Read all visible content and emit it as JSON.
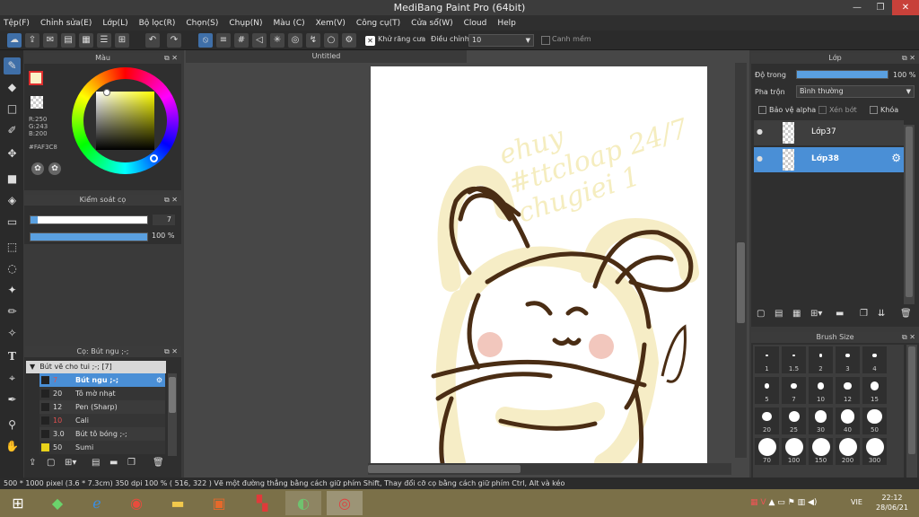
{
  "app": {
    "title": "MediBang Paint Pro (64bit)"
  },
  "menu": [
    "Tệp(F)",
    "Chỉnh sửa(E)",
    "Lớp(L)",
    "Bộ lọc(R)",
    "Chọn(S)",
    "Chụp(N)",
    "Màu (C)",
    "Xem(V)",
    "Công cụ(T)",
    "Cửa sổ(W)",
    "Cloud",
    "Help"
  ],
  "toolbar": {
    "antialias": "Khử răng cưa",
    "adjust": "Điều chỉnh",
    "adjust_value": "10",
    "canh_mem": "Canh mềm"
  },
  "color_panel": {
    "title": "Màu",
    "r": "R:250",
    "g": "G:243",
    "b": "B:200",
    "hex": "#FAF3C8",
    "primary": "#FAF3C8"
  },
  "brush_control": {
    "title": "Kiểm soát cọ",
    "size": "7",
    "opacity": "100 %",
    "size_fraction": 0.06,
    "opacity_fraction": 1.0
  },
  "brush_panel": {
    "title": "Cọ: Bút ngu ;-;",
    "group": "Bút vẽ cho tui ;-; [7]",
    "items": [
      {
        "size": "7",
        "name": "Bút ngu ;-;",
        "selected": true,
        "size_red": true
      },
      {
        "size": "20",
        "name": "Tô mờ nhạt",
        "selected": false,
        "size_red": false
      },
      {
        "size": "12",
        "name": "Pen (Sharp)",
        "selected": false,
        "size_red": false
      },
      {
        "size": "10",
        "name": "Cali",
        "selected": false,
        "size_red": true
      },
      {
        "size": "3.0",
        "name": "Bút tô bóng ;-;",
        "selected": false,
        "size_red": false
      },
      {
        "size": "50",
        "name": "Sumi",
        "selected": false,
        "size_red": false
      }
    ]
  },
  "canvas": {
    "tab": "Untitled",
    "sketch_text": "ehuy\n#ttcloap 24/7\nchugiei 1"
  },
  "layer_panel": {
    "title": "Lớp",
    "opacity_label": "Độ trong",
    "opacity_value": "100 %",
    "opacity_fraction": 1.0,
    "blend_label": "Pha trộn",
    "blend_value": "Bình thường",
    "protect_alpha": "Bảo vệ alpha",
    "clipping": "Xén bớt",
    "lock": "Khóa",
    "layers": [
      {
        "name": "Lớp37",
        "selected": false
      },
      {
        "name": "Lớp38",
        "selected": true
      }
    ]
  },
  "brush_size": {
    "title": "Brush Size",
    "sizes": [
      "1",
      "1.5",
      "2",
      "3",
      "4",
      "5",
      "7",
      "10",
      "12",
      "15",
      "20",
      "25",
      "30",
      "40",
      "50",
      "70",
      "100",
      "150",
      "200",
      "300"
    ]
  },
  "status": {
    "text": "500 * 1000 pixel   (3.6 * 7.3cm)   350 dpi   100 %   ( 516, 322 )   Vẽ một đường thẳng bằng cách giữ phím Shift, Thay đổi cỡ cọ bằng cách giữ phím Ctrl, Alt và kéo"
  },
  "taskbar": {
    "lang": "VIE",
    "time": "22:12",
    "date": "28/06/21"
  }
}
